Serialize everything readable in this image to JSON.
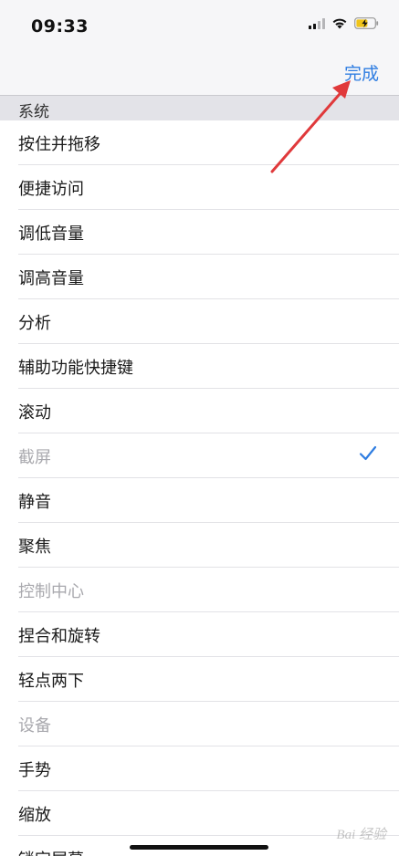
{
  "status_bar": {
    "time": "09:33",
    "icons": [
      "cellular-signal-icon",
      "wifi-icon",
      "battery-charging-icon"
    ]
  },
  "nav": {
    "done_label": "完成"
  },
  "section": {
    "title": "系统"
  },
  "items": [
    {
      "label": "按住并拖移",
      "state": "normal"
    },
    {
      "label": "便捷访问",
      "state": "normal"
    },
    {
      "label": "调低音量",
      "state": "normal"
    },
    {
      "label": "调高音量",
      "state": "normal"
    },
    {
      "label": "分析",
      "state": "normal"
    },
    {
      "label": "辅助功能快捷键",
      "state": "normal"
    },
    {
      "label": "滚动",
      "state": "normal"
    },
    {
      "label": "截屏",
      "state": "disabled",
      "checked": true
    },
    {
      "label": "静音",
      "state": "normal"
    },
    {
      "label": "聚焦",
      "state": "normal"
    },
    {
      "label": "控制中心",
      "state": "disabled"
    },
    {
      "label": "捏合和旋转",
      "state": "normal"
    },
    {
      "label": "轻点两下",
      "state": "normal"
    },
    {
      "label": "设备",
      "state": "disabled"
    },
    {
      "label": "手势",
      "state": "normal"
    },
    {
      "label": "缩放",
      "state": "normal"
    },
    {
      "label": "锁定屏幕",
      "state": "normal"
    }
  ],
  "colors": {
    "accent": "#2f7de1",
    "annotation_arrow": "#e0393b"
  },
  "watermark": "Bai 经验"
}
